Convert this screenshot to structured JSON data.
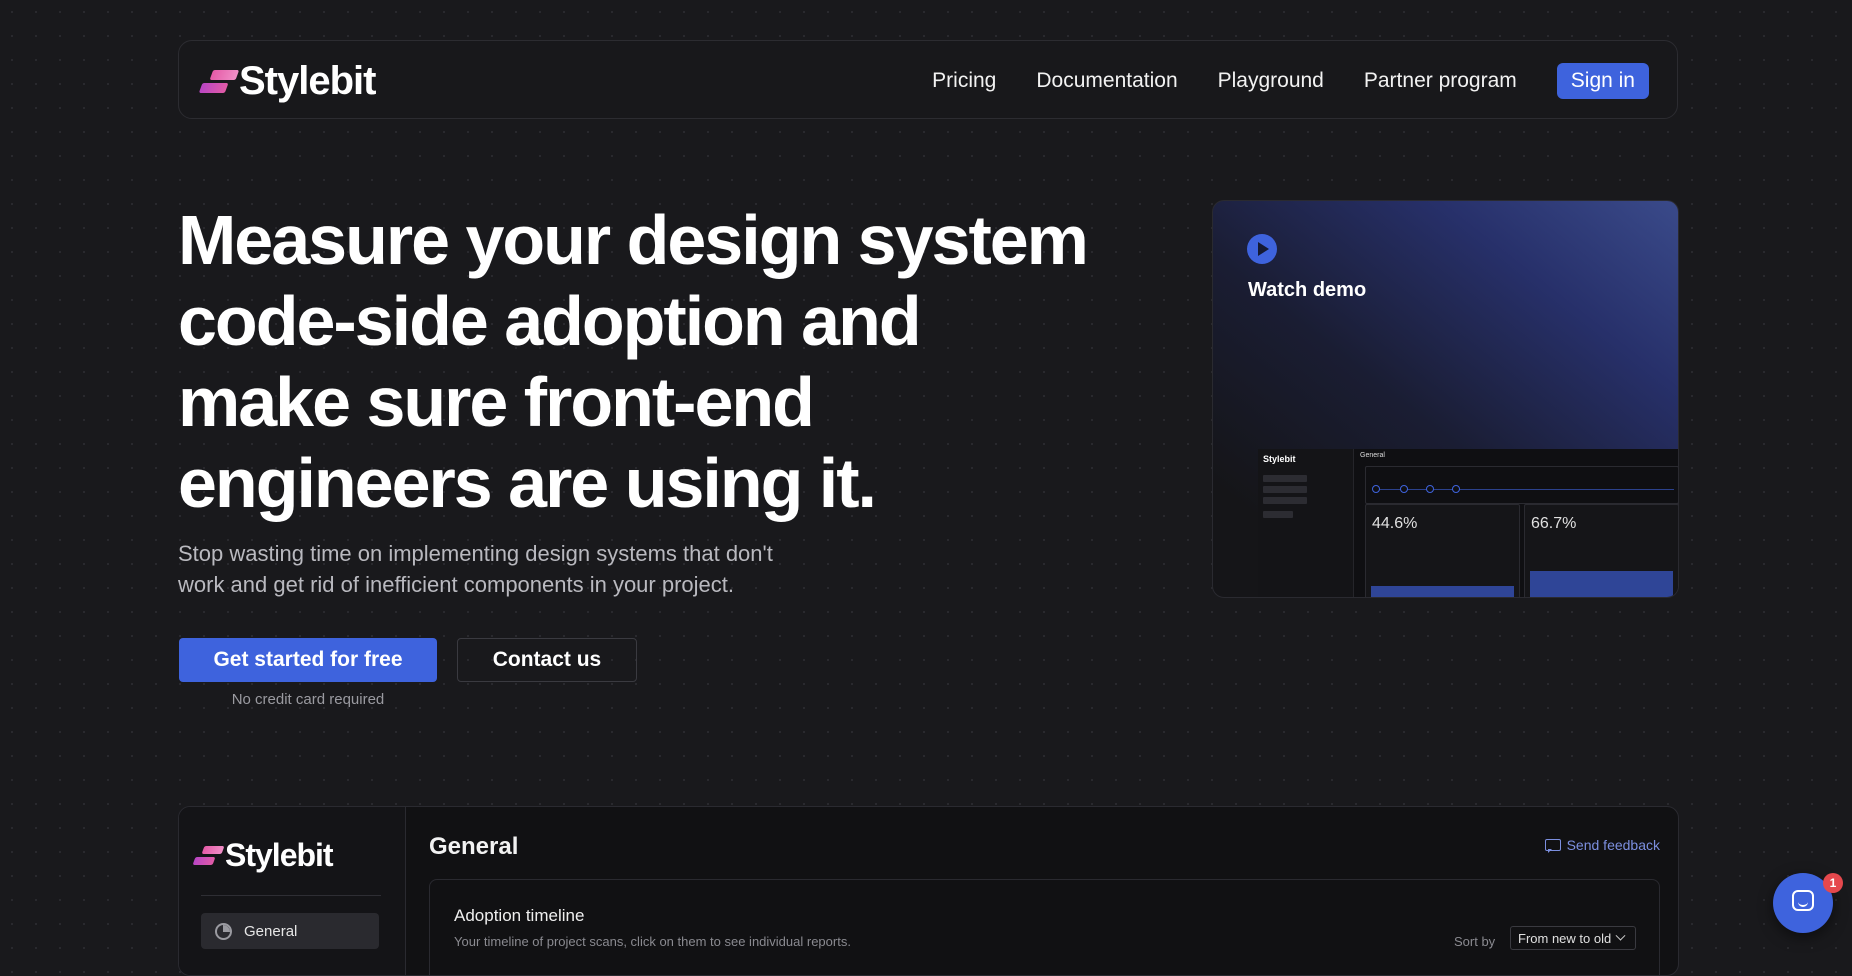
{
  "nav": {
    "brand": "Stylebit",
    "links": [
      "Pricing",
      "Documentation",
      "Playground",
      "Partner program"
    ],
    "signin": "Sign in"
  },
  "hero": {
    "headline": "Measure your design system code-side adoption and make sure front-end engineers are using it.",
    "subline": "Stop wasting time on implementing design systems that don't work and get rid of inefficient components in your project.",
    "primary_cta": "Get started for free",
    "secondary_cta": "Contact us",
    "note": "No credit card required"
  },
  "demo": {
    "label": "Watch demo",
    "preview": {
      "brand": "Stylebit",
      "title": "General",
      "card_values": [
        "44.6%",
        "66.7%"
      ],
      "bar_levels": [
        0.2,
        0.4
      ]
    }
  },
  "dashboard": {
    "brand": "Stylebit",
    "nav_item": "General",
    "title": "General",
    "feedback": "Send feedback",
    "panel": {
      "title": "Adoption timeline",
      "subtitle": "Your timeline of project scans, click on them to see individual reports.",
      "sort_label": "Sort by",
      "sort_value": "From new to old"
    }
  },
  "chat": {
    "badge": "1"
  },
  "colors": {
    "background": "#19191c",
    "accent": "#3e63dd",
    "logo_pink": "#e55ba7",
    "badge_red": "#e5484d"
  }
}
